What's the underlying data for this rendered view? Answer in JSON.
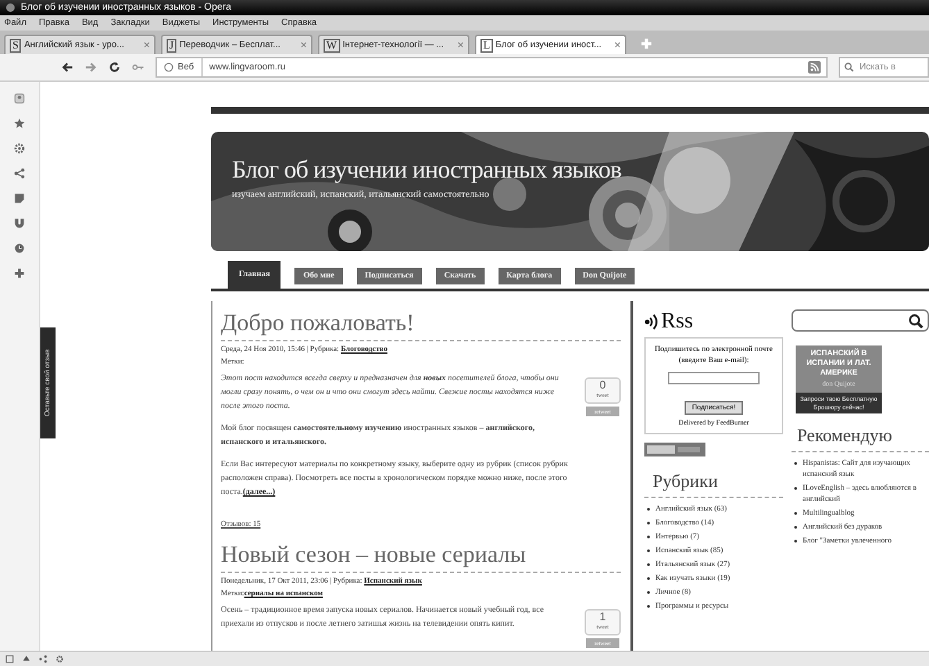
{
  "window": {
    "title": "Блог об изучении иностранных языков - Opera"
  },
  "menu": [
    "Файл",
    "Правка",
    "Вид",
    "Закладки",
    "Виджеты",
    "Инструменты",
    "Справка"
  ],
  "tabs": [
    {
      "favicon": "S",
      "label": "Английский язык - уро...",
      "close": "×",
      "selected": false
    },
    {
      "favicon": "J",
      "label": "Переводчик – Бесплат...",
      "close": "×",
      "selected": false
    },
    {
      "favicon": "W",
      "label": "Інтернет-технології — ...",
      "close": "×",
      "selected": false
    },
    {
      "favicon": "L",
      "label": "Блог об изучении иност...",
      "close": "×",
      "selected": true
    }
  ],
  "address_bar": {
    "web_button": "Веб",
    "url": "www.lingvaroom.ru",
    "search_placeholder": "Искать в"
  },
  "feedback_tab": "Оставьте свой отзыв",
  "blog": {
    "title": "Блог об изучении иностранных языков",
    "subtitle": "изучаем английский, испанский, итальянский самостоятельно",
    "nav": [
      {
        "label": "Главная",
        "selected": true
      },
      {
        "label": "Обо мне",
        "selected": false
      },
      {
        "label": "Подписаться",
        "selected": false
      },
      {
        "label": "Скачать",
        "selected": false
      },
      {
        "label": "Карта блога",
        "selected": false
      },
      {
        "label": "Don Quijote",
        "selected": false
      }
    ]
  },
  "posts": [
    {
      "title": "Добро пожаловать!",
      "meta": "Среда, 24 Ноя 2010, 15:46 | Рубрика:",
      "category": "Блоговодство",
      "tags_label": "Метки:",
      "count": "0",
      "count_label": "tweet",
      "tweet_button": "retweet",
      "paragraphs": [
        {
          "text": "Этот пост находится всегда сверху и предназначен для **новых** посетителей блога, чтобы они могли сразу понять, о чем он и что они смогут здесь найти. Свежие посты находятся ниже после этого поста.",
          "italic": true
        },
        {
          "text": "Мой блог посвящен **самостоятельному изучению** иностранных языков – **английского, испанского и итальянского.**",
          "italic": false
        },
        {
          "text": "Если Вас интересуют материалы по конкретному языку, выберите одну из рубрик (список рубрик расположен справа). Посмотреть все посты в хронологическом порядке можно ниже, после этого поста.",
          "italic": false,
          "more_link": "(далее...)"
        }
      ],
      "comments": "Отзывов: 15"
    },
    {
      "title": "Новый сезон – новые сериалы",
      "meta": "Понедельник, 17 Окт 2011, 23:06 | Рубрика:",
      "category": "Испанский язык",
      "tags_label": "Метки:",
      "tag": "сериалы на испанском",
      "count": "1",
      "count_label": "tweet",
      "tweet_button": "retweet",
      "paragraphs": [
        {
          "text": "Осень – традиционное время запуска новых сериалов. Начинается новый учебный год, все приехали из отпусков и после летнего затишья жизнь на телевидении опять кипит.",
          "italic": false
        }
      ]
    }
  ],
  "subscribe": {
    "logo": "Rss",
    "prompt": "Подпишитесь по электронной почте (введите Ваш e-mail):",
    "button": "Подписаться!",
    "delivered": "Delivered by FeedBurner"
  },
  "categories": {
    "title": "Рубрики",
    "items": [
      "Английский язык (63)",
      "Блоговодство (14)",
      "Интервью (7)",
      "Испанский язык (85)",
      "Итальянский язык (27)",
      "Как изучать языки (19)",
      "Личное (8)",
      "Программы и ресурсы"
    ]
  },
  "ad": {
    "headline": "ИСПАНСКИЙ В ИСПАНИИ И ЛАТ. АМЕРИКЕ",
    "brand": "don Quijote",
    "cta": "Запроси твою Бесплатную Брошюру сейчас!"
  },
  "recommend": {
    "title": "Рекомендую",
    "items": [
      "Hispanistas: Сайт для изучающих испанский язык",
      "ILoveEnglish – здесь влюбляются в английский",
      "Multilingualblog",
      "Английский без дураков",
      "Блог \"Заметки увлеченного"
    ]
  }
}
